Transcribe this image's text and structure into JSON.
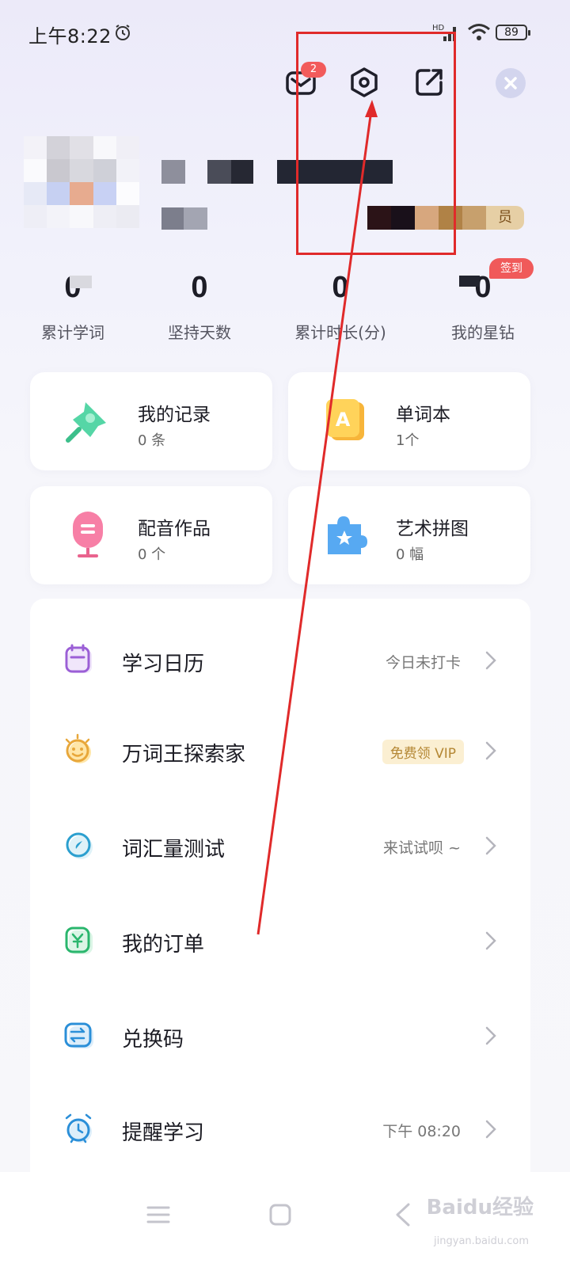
{
  "status_bar": {
    "time": "上午8:22",
    "signal": "HD",
    "battery": "89"
  },
  "header": {
    "mail_badge": "2",
    "member_tag": "员"
  },
  "stats": [
    {
      "value": "0",
      "label": "累计学词"
    },
    {
      "value": "0",
      "label": "坚持天数"
    },
    {
      "value": "0",
      "label": "累计时长(分)"
    },
    {
      "value": "0",
      "label": "我的星钻"
    }
  ],
  "signin_label": "签到",
  "cards": [
    {
      "title": "我的记录",
      "sub": "0 条"
    },
    {
      "title": "单词本",
      "sub": "1个"
    },
    {
      "title": "配音作品",
      "sub": "0 个"
    },
    {
      "title": "艺术拼图",
      "sub": "0 幅"
    }
  ],
  "list": [
    {
      "label": "学习日历",
      "value": "今日未打卡"
    },
    {
      "label": "万词王探索家",
      "value": "免费领 VIP"
    },
    {
      "label": "词汇量测试",
      "value": "来试试呗 ~"
    },
    {
      "label": "我的订单",
      "value": ""
    },
    {
      "label": "兑换码",
      "value": ""
    },
    {
      "label": "提醒学习",
      "value": "下午 08:20"
    }
  ],
  "watermark": {
    "brand": "Baidu经验",
    "url": "jingyan.baidu.com"
  },
  "colors": {
    "accent_red": "#e02a2a",
    "badge_red": "#f25b5b",
    "vip_gold": "#b48734"
  }
}
